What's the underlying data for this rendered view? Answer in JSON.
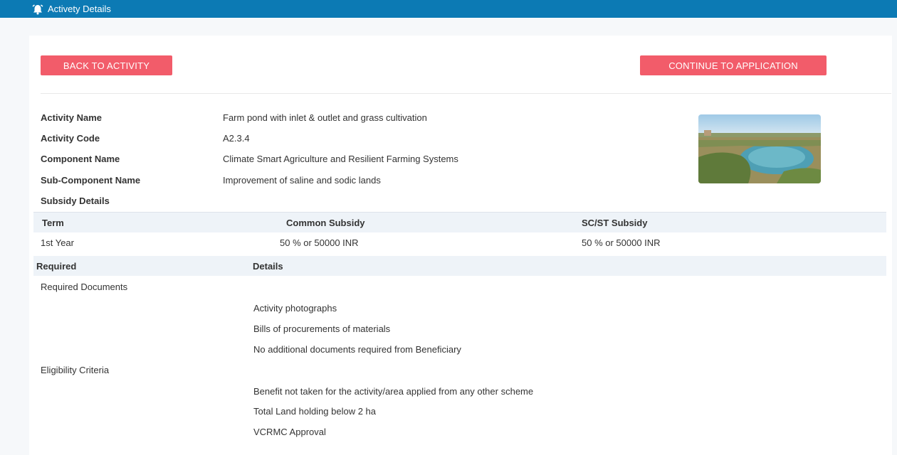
{
  "window": {
    "title": "Activety Details",
    "icon": "alarm-bell-icon"
  },
  "buttons": {
    "back": "BACK TO ACTIVITY",
    "continue": "CONTINUE TO APPLICATION"
  },
  "colors": {
    "header_bar": "#0c7ab4",
    "button": "#f25c6a",
    "table_header": "#eef3f8"
  },
  "activity": [
    {
      "label": "Activity Name",
      "value": "Farm pond with inlet & outlet and grass cultivation"
    },
    {
      "label": "Activity Code",
      "value": "A2.3.4"
    },
    {
      "label": "Component Name",
      "value": "Climate Smart Agriculture and Resilient Farming Systems"
    },
    {
      "label": "Sub-Component Name",
      "value": "Improvement of saline and sodic lands"
    }
  ],
  "subsidy": {
    "title": "Subsidy Details",
    "headers": [
      "Term",
      "Common Subsidy",
      "SC/ST Subsidy"
    ],
    "rows": [
      [
        "1st Year",
        "50 % or 50000 INR",
        "50 % or 50000 INR"
      ]
    ]
  },
  "requirements": {
    "headers": [
      "Required",
      "Details"
    ],
    "sections": [
      {
        "title": "Required Documents",
        "items": [
          "Activity photographs",
          "Bills of procurements of materials",
          "No additional documents required from Beneficiary"
        ]
      },
      {
        "title": "Eligibility Criteria",
        "items": [
          "Benefit not taken for the activity/area applied from any other scheme",
          "Total Land holding below 2 ha",
          "VCRMC Approval"
        ]
      }
    ]
  }
}
